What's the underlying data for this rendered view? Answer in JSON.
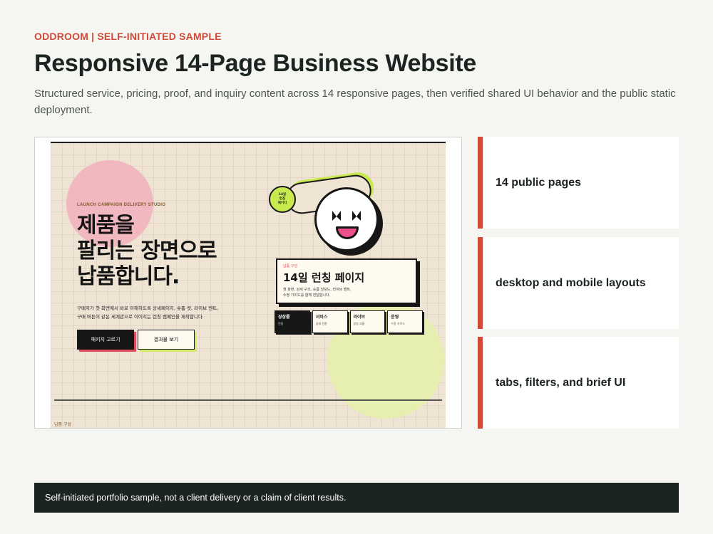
{
  "header": {
    "eyebrow": "ODDROOM | SELF-INITIATED SAMPLE",
    "title": "Responsive 14-Page Business Website",
    "description": "Structured service, pricing, proof, and inquiry content across 14 responsive pages, then verified shared UI behavior and the public static deployment."
  },
  "preview": {
    "studio_label": "LAUNCH CAMPAIGN DELIVERY STUDIO",
    "headline": "제품을\n팔리는 장면으로\n납품합니다.",
    "intro": "구매자가 첫 화면에서 바로 이해하도록 상세페이지, 숏폼 컷, 라이브 멘트,\n구매 버튼이 같은 세계관으로 이어지는 런칭 캠페인을 제작합니다.",
    "primary_button": "패키지 고르기",
    "secondary_button": "결과물 보기",
    "badge_text": "14일\n런칭\n패키지",
    "card": {
      "kicker": "납품 구성",
      "title": "14일 런칭 페이지",
      "text": "첫 화면, 상세 구조, 숏폼 컷보드, 라이브 멘트,\n수정 가이드를 함께 전달합니다."
    },
    "tabs": [
      {
        "name": "상상룸",
        "sub": "런칭"
      },
      {
        "name": "서비스",
        "sub": "상세 전환"
      },
      {
        "name": "라이브",
        "sub": "방송 흐름"
      },
      {
        "name": "운영",
        "sub": "수정 가이드"
      }
    ],
    "bottom_label": "납품 구성",
    "colors": {
      "pink": "#f2b8bf",
      "lime": "#c9ea4f",
      "accent": "#e2495d"
    }
  },
  "features": [
    {
      "label": "14 public pages"
    },
    {
      "label": "desktop and mobile layouts"
    },
    {
      "label": "tabs, filters, and brief UI"
    }
  ],
  "footer": {
    "note": "Self-initiated portfolio sample, not a client delivery or a claim of client results."
  },
  "colors": {
    "accent": "#cf4b37",
    "dark": "#1b2420",
    "background": "#f5f5f2"
  }
}
